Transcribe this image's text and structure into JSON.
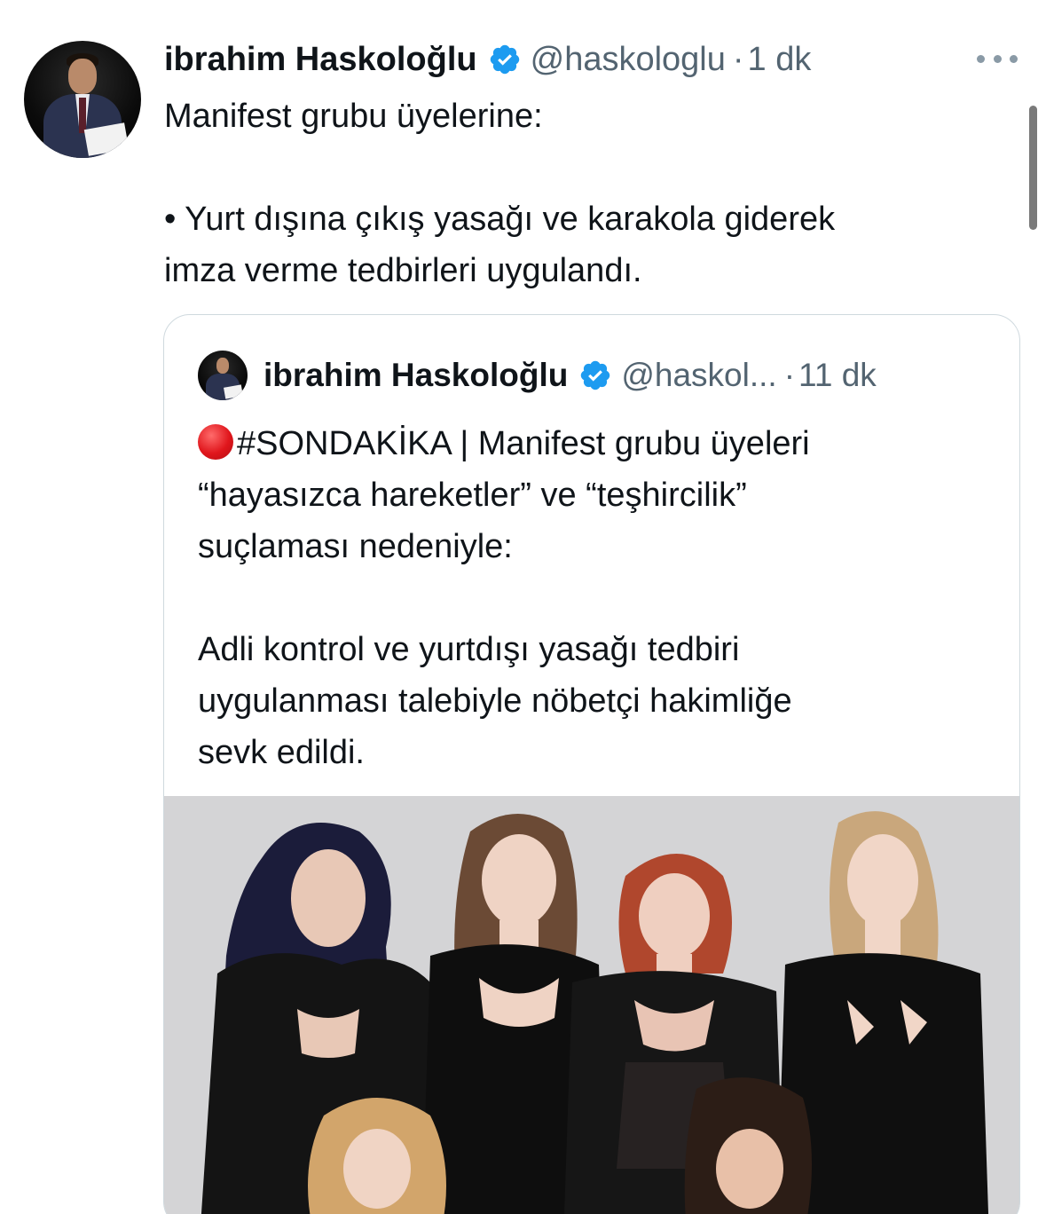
{
  "tweet": {
    "author_name": "ibrahim Haskoloğlu",
    "handle": "@haskologlu",
    "separator": "·",
    "time": "1 dk",
    "text_line1": "Manifest grubu üyelerine:",
    "text_line2": "• Yurt dışına çıkış yasağı ve karakola giderek",
    "text_line3": "imza verme tedbirleri uygulandı."
  },
  "quoted": {
    "author_name": "ibrahim Haskoloğlu",
    "handle": "@haskol...",
    "separator": "·",
    "time": "11 dk",
    "hashtag_line": "#SONDAKİKA | Manifest grubu üyeleri",
    "line2": "“hayasızca hareketler” ve “teşhircilik”",
    "line3": "suçlaması nedeniyle:",
    "line4": "Adli kontrol ve yurtdışı yasağı tedbiri",
    "line5": "uygulanması talebiyle nöbetçi hakimliğe",
    "line6": "sevk edildi."
  },
  "icons": {
    "verified": "verified-badge-icon",
    "more": "more-options-icon",
    "red_circle": "red-circle-emoji-icon"
  },
  "colors": {
    "verified_blue": "#1d9bf0",
    "secondary_text": "#536471",
    "border": "#cfd9de"
  }
}
